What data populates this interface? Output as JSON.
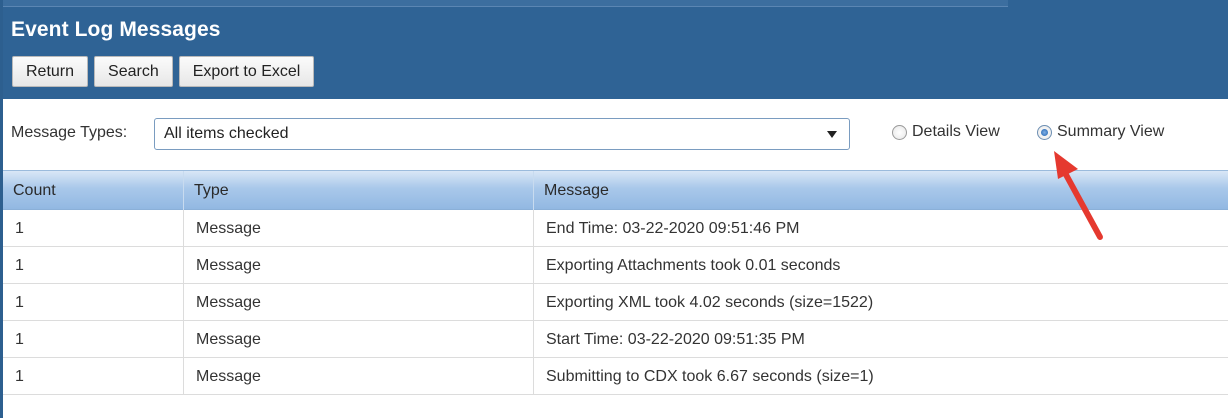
{
  "header": {
    "title": "Event Log Messages",
    "buttons": {
      "return_label": "Return",
      "search_label": "Search",
      "export_label": "Export to Excel"
    }
  },
  "filter": {
    "message_types_label": "Message Types:",
    "message_types_value": "All items checked",
    "views": {
      "details_label": "Details View",
      "summary_label": "Summary View",
      "selected": "Summary View"
    }
  },
  "grid": {
    "columns": [
      "Count",
      "Type",
      "Message"
    ],
    "rows": [
      [
        "1",
        "Message",
        "End Time: 03-22-2020 09:51:46 PM"
      ],
      [
        "1",
        "Message",
        "Exporting Attachments took 0.01 seconds"
      ],
      [
        "1",
        "Message",
        "Exporting XML took 4.02 seconds (size=1522)"
      ],
      [
        "1",
        "Message",
        "Start Time: 03-22-2020 09:51:35 PM"
      ],
      [
        "1",
        "Message",
        "Submitting to CDX took 6.67 seconds (size=1)"
      ]
    ]
  },
  "colors": {
    "header_background": "#2f6395",
    "annotation_arrow": "#e5392f"
  },
  "icons": {
    "dropdown": "chevron-down-icon",
    "annotation": "red-arrow-icon"
  }
}
